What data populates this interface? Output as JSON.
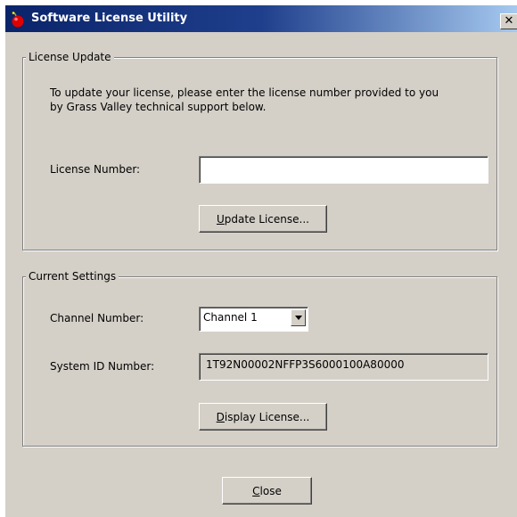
{
  "window": {
    "title": "Software License Utility",
    "close_glyph": "✕"
  },
  "license_update": {
    "group_label": "License Update",
    "instructions_line1": "To update your license, please enter the license number provided to you",
    "instructions_line2": "by Grass Valley technical support below.",
    "license_number_label": "License Number:",
    "license_number_value": "",
    "update_button_first": "U",
    "update_button_rest": "pdate License..."
  },
  "current_settings": {
    "group_label": "Current Settings",
    "channel_label": "Channel Number:",
    "channel_value": "Channel 1",
    "system_id_label": "System ID Number:",
    "system_id_value": "1T92N00002NFFP3S6000100A80000",
    "display_button_first": "D",
    "display_button_rest": "isplay License..."
  },
  "footer": {
    "close_button_first": "C",
    "close_button_rest": "lose"
  },
  "colors": {
    "title_bar_start": "#0a246a",
    "title_bar_end": "#a6caf0",
    "dialog_face": "#d4d0c8"
  },
  "icons": {
    "app_icon": "red-bomb-icon",
    "close_icon": "close-icon",
    "dropdown_icon": "chevron-down-icon"
  }
}
